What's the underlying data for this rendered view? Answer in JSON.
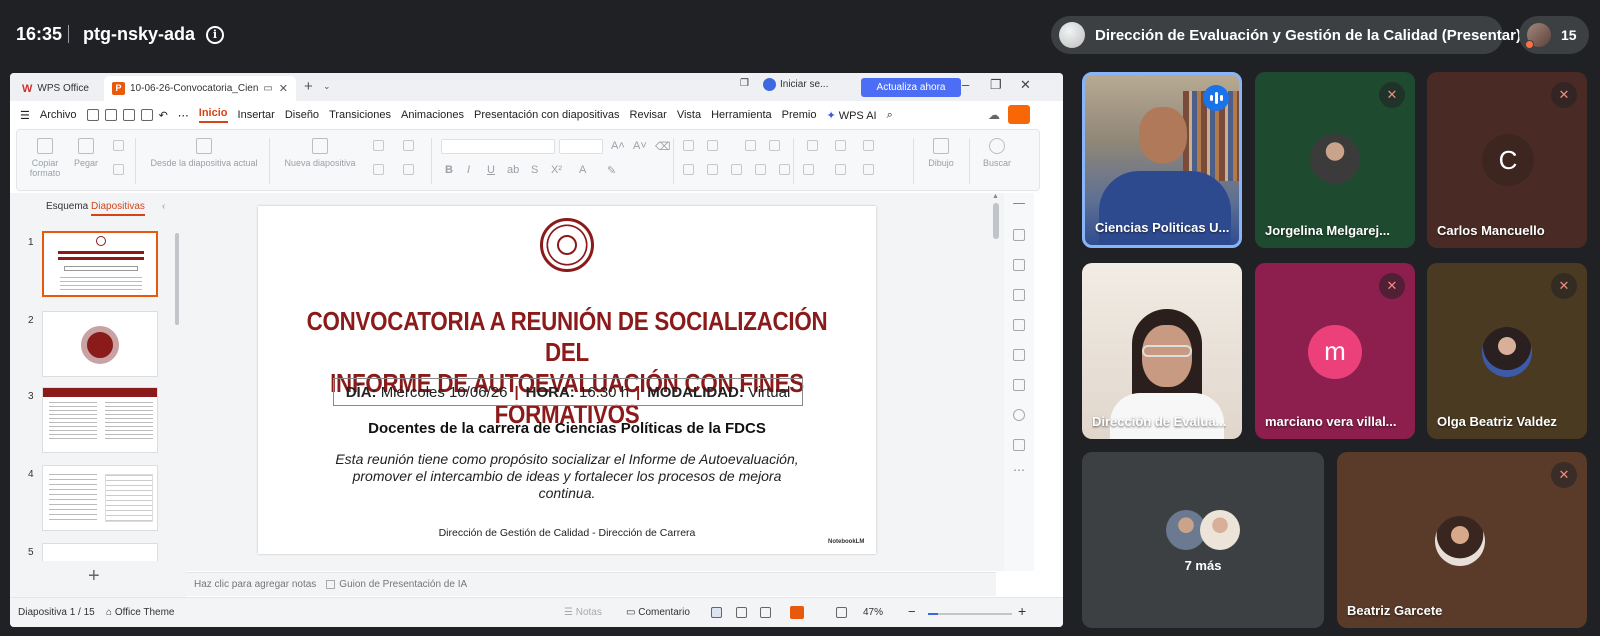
{
  "meet": {
    "time": "16:35",
    "code": "ptg-nsky-ada",
    "info_glyph": "i"
  },
  "presenter_chip": {
    "label": "Dirección de Evaluación y Gestión de la Calidad (Presentar)"
  },
  "participants": {
    "count": "15"
  },
  "wps": {
    "home_tab": "WPS Office",
    "doc_tab": "10-06-26-Convocatoria_Cien",
    "login": "Iniciar se...",
    "update_button": "Actualiza ahora",
    "menu": [
      "Archivo",
      "Inicio",
      "Insertar",
      "Diseño",
      "Transiciones",
      "Animaciones",
      "Presentación con diapositivas",
      "Revisar",
      "Vista",
      "Herramienta",
      "Premio",
      "WPS AI"
    ],
    "ribbon": {
      "copy": "Copiar",
      "format": "formato",
      "paste": "Pegar",
      "from_current": "Desde la diapositiva actual",
      "new_slide": "Nueva diapositiva",
      "draw": "Dibujo",
      "search": "Buscar"
    },
    "panel_tabs": {
      "outline": "Esquema",
      "slides": "Diapositivas"
    },
    "thumb_numbers": [
      "1",
      "2",
      "3",
      "4",
      "5"
    ],
    "notes_placeholder": "Haz clic para agregar notas",
    "ai_script": "Guion de Presentación de IA",
    "status": {
      "slide": "Diapositiva 1 / 15",
      "theme": "Office Theme",
      "notes": "Notas",
      "comment": "Comentario",
      "zoom": "47%"
    }
  },
  "slide": {
    "title_line1": "CONVOCATORIA A REUNIÓN DE SOCIALIZACIÓN DEL",
    "title_line2": "INFORME DE AUTOEVALUACIÓN CON FINES FORMATIVOS",
    "day_label": "DÍA:",
    "day_value": "Miércoles 10/06/26",
    "hour_label": "HORA:",
    "hour_value": "16:30 h",
    "mode_label": "MODALIDAD:",
    "mode_value": "Virtual",
    "separator": "|",
    "subtitle": "Docentes de la carrera de Ciencias Políticas de la FDCS",
    "body": "Esta reunión tiene como propósito socializar el Informe de Autoevaluación, promover el intercambio de ideas y fortalecer los procesos de mejora continua.",
    "footer": "Dirección de Gestión de Calidad - Dirección de Carrera",
    "watermark": "NotebookLM"
  },
  "tiles": [
    {
      "name": "Ciencias Politicas U..."
    },
    {
      "name": "Jorgelina Melgarej..."
    },
    {
      "name": "Carlos Mancuello",
      "initial": "C"
    },
    {
      "name": "Dirección de Evalua..."
    },
    {
      "name": "marciano vera villal...",
      "initial": "m"
    },
    {
      "name": "Olga Beatriz Valdez"
    },
    {
      "name": "7 más"
    },
    {
      "name": "Beatriz Garcete"
    }
  ],
  "colors": {
    "accent": "#d84315",
    "slide_title": "#8b1a1a",
    "meet_bg": "#202124",
    "speaking": "#1a73e8",
    "avatar_pink": "#ec407a"
  }
}
